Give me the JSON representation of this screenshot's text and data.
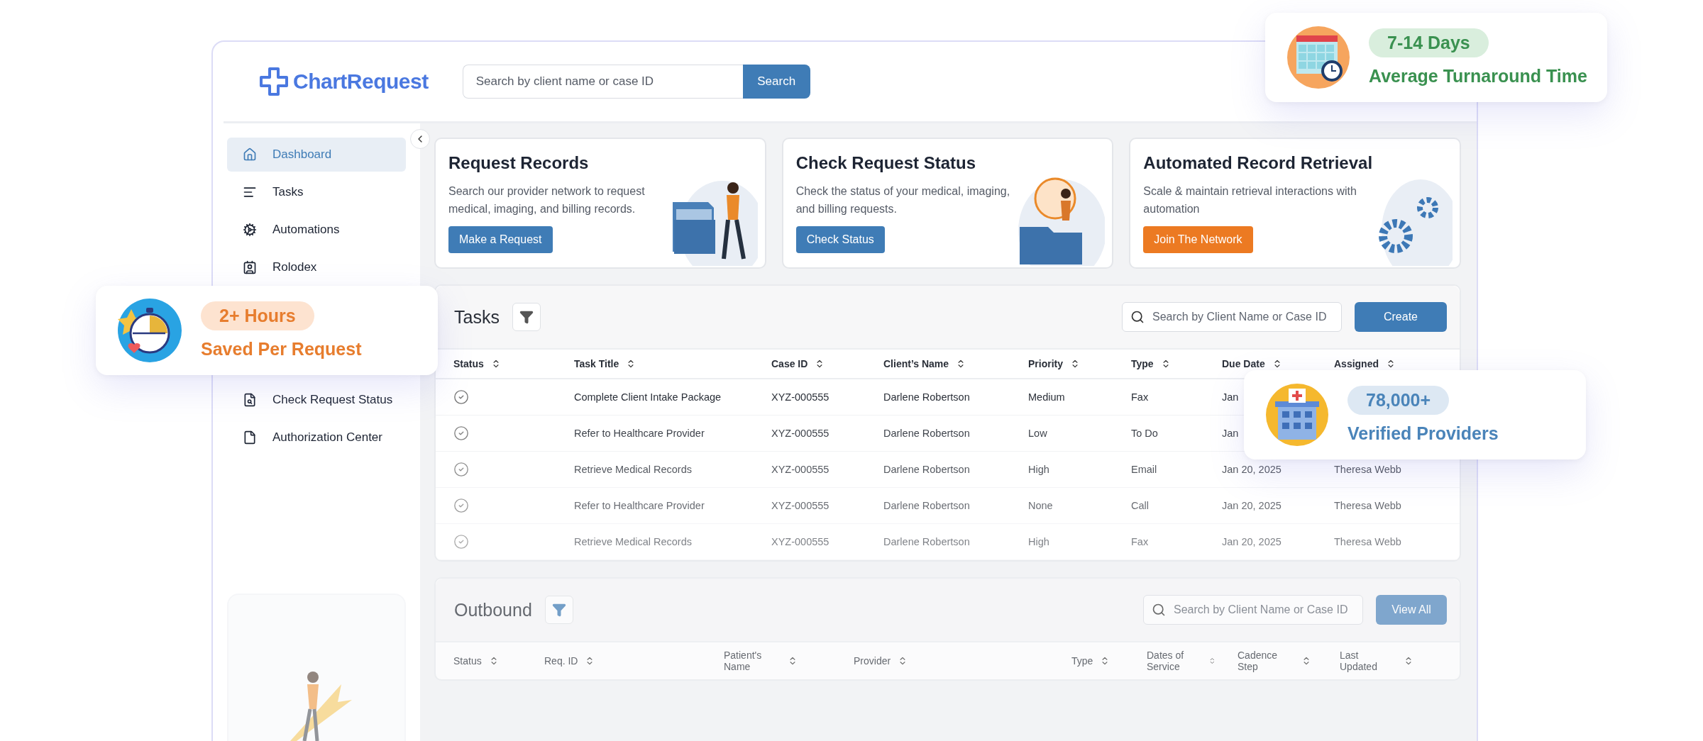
{
  "logo": {
    "text": "ChartRequest"
  },
  "search": {
    "placeholder": "Search by client name or case ID",
    "button": "Search"
  },
  "sidebar": {
    "items": [
      {
        "label": "Dashboard",
        "selected": true
      },
      {
        "label": "Tasks",
        "selected": false
      },
      {
        "label": "Automations",
        "selected": false
      },
      {
        "label": "Rolodex",
        "selected": false
      }
    ],
    "lower_items": [
      {
        "label": "Check Request Status",
        "selected": false
      },
      {
        "label": "Authorization Center",
        "selected": false
      }
    ]
  },
  "cards": [
    {
      "title": "Request Records",
      "text": "Search our provider network to request medical, imaging, and billing records.",
      "button": "Make a Request",
      "kind": "primary"
    },
    {
      "title": "Check Request Status",
      "text": "Check the status of your medical, imaging, and billing requests.",
      "button": "Check Status",
      "kind": "primary"
    },
    {
      "title": "Automated Record Retrieval",
      "text": "Scale & maintain retrieval interactions with automation",
      "button": "Join The Network",
      "kind": "accent"
    }
  ],
  "tasks": {
    "title": "Tasks",
    "search_placeholder": "Search by Client Name or Case ID",
    "button": "Create",
    "columns": [
      "Status",
      "Task Title",
      "Case ID",
      "Client’s Name",
      "Priority",
      "Type",
      "Due Date",
      "Assigned"
    ],
    "rows": [
      {
        "cells": [
          "",
          "Complete Client Intake Package",
          "XYZ-000555",
          "Darlene Robertson",
          "Medium",
          "Fax",
          "Jan"
        ]
      },
      {
        "cells": [
          "",
          "Refer to Healthcare Provider",
          "XYZ-000555",
          "Darlene Robertson",
          "Low",
          "To Do",
          "Jan"
        ]
      },
      {
        "cells": [
          "",
          "Retrieve Medical Records",
          "XYZ-000555",
          "Darlene Robertson",
          "High",
          "Email",
          "Jan 20, 2025",
          "Theresa Webb"
        ]
      },
      {
        "cells": [
          "",
          "Refer to Healthcare Provider",
          "XYZ-000555",
          "Darlene Robertson",
          "None",
          "Call",
          "Jan 20, 2025",
          "Theresa Webb"
        ]
      },
      {
        "cells": [
          "",
          "Retrieve Medical Records",
          "XYZ-000555",
          "Darlene Robertson",
          "High",
          "Fax",
          "Jan 20, 2025",
          "Theresa Webb"
        ]
      }
    ]
  },
  "outbound": {
    "title": "Outbound",
    "search_placeholder": "Search by Client Name or Case ID",
    "button": "View All",
    "columns": [
      "Status",
      "Req. ID",
      "Patient's Name",
      "Provider",
      "Type",
      "Dates of Service",
      "Cadence Step",
      "Last Updated"
    ]
  },
  "stats": [
    {
      "kind": "turnaround",
      "value": "7-14 Days",
      "label": "Average Turnaround Time"
    },
    {
      "kind": "saved",
      "value": "2+ Hours",
      "label": "Saved Per Request"
    },
    {
      "kind": "providers",
      "value": "78,000+",
      "label": "Verified Providers"
    }
  ]
}
